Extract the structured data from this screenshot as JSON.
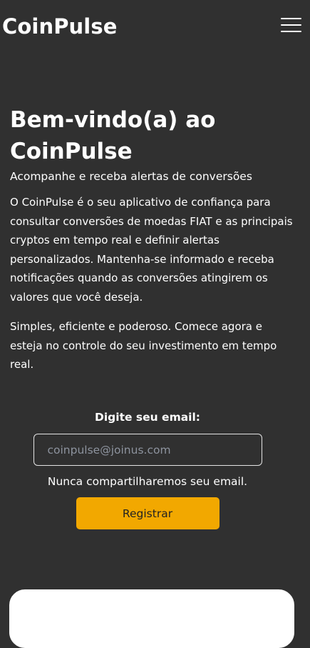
{
  "header": {
    "brand": "CoinPulse",
    "menu_icon": "hamburger-menu-icon"
  },
  "hero": {
    "title": "Bem-vindo(a) ao CoinPulse",
    "subtitle": "Acompanhe e receba alertas de conversões",
    "paragraph_1": "O CoinPulse é o seu aplicativo de confiança para consultar conversões de moedas FIAT e as principais cryptos em tempo real e definir alertas personalizados. Mantenha-se informado e receba notificações quando as conversões atingirem os valores que você deseja.",
    "paragraph_2": "Simples, eficiente e poderoso. Comece agora e esteja no controle do seu investimento em tempo real."
  },
  "signup": {
    "email_label": "Digite seu email:",
    "email_value": "",
    "email_placeholder": "coinpulse@joinus.com",
    "email_help": "Nunca compartilharemos seu email.",
    "register_label": "Registrar"
  },
  "colors": {
    "background": "#303030",
    "accent": "#f2a800",
    "text": "#ffffff",
    "placeholder": "#8d939e"
  }
}
